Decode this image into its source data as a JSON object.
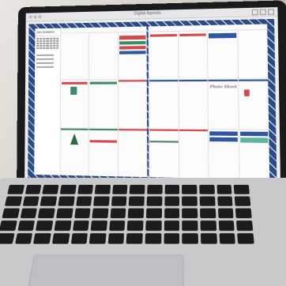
{
  "window": {
    "title": "Digital Agenda"
  },
  "planner": {
    "left_page": {
      "month_label": "DECEMBER"
    },
    "right_page": {
      "note_text": "Photo Shoot"
    }
  },
  "colors": {
    "red": "#d24b4b",
    "green": "#3d8a66",
    "blue": "#2f56a0",
    "teal": "#5fb3a3",
    "pattern": "#2c4a86"
  }
}
